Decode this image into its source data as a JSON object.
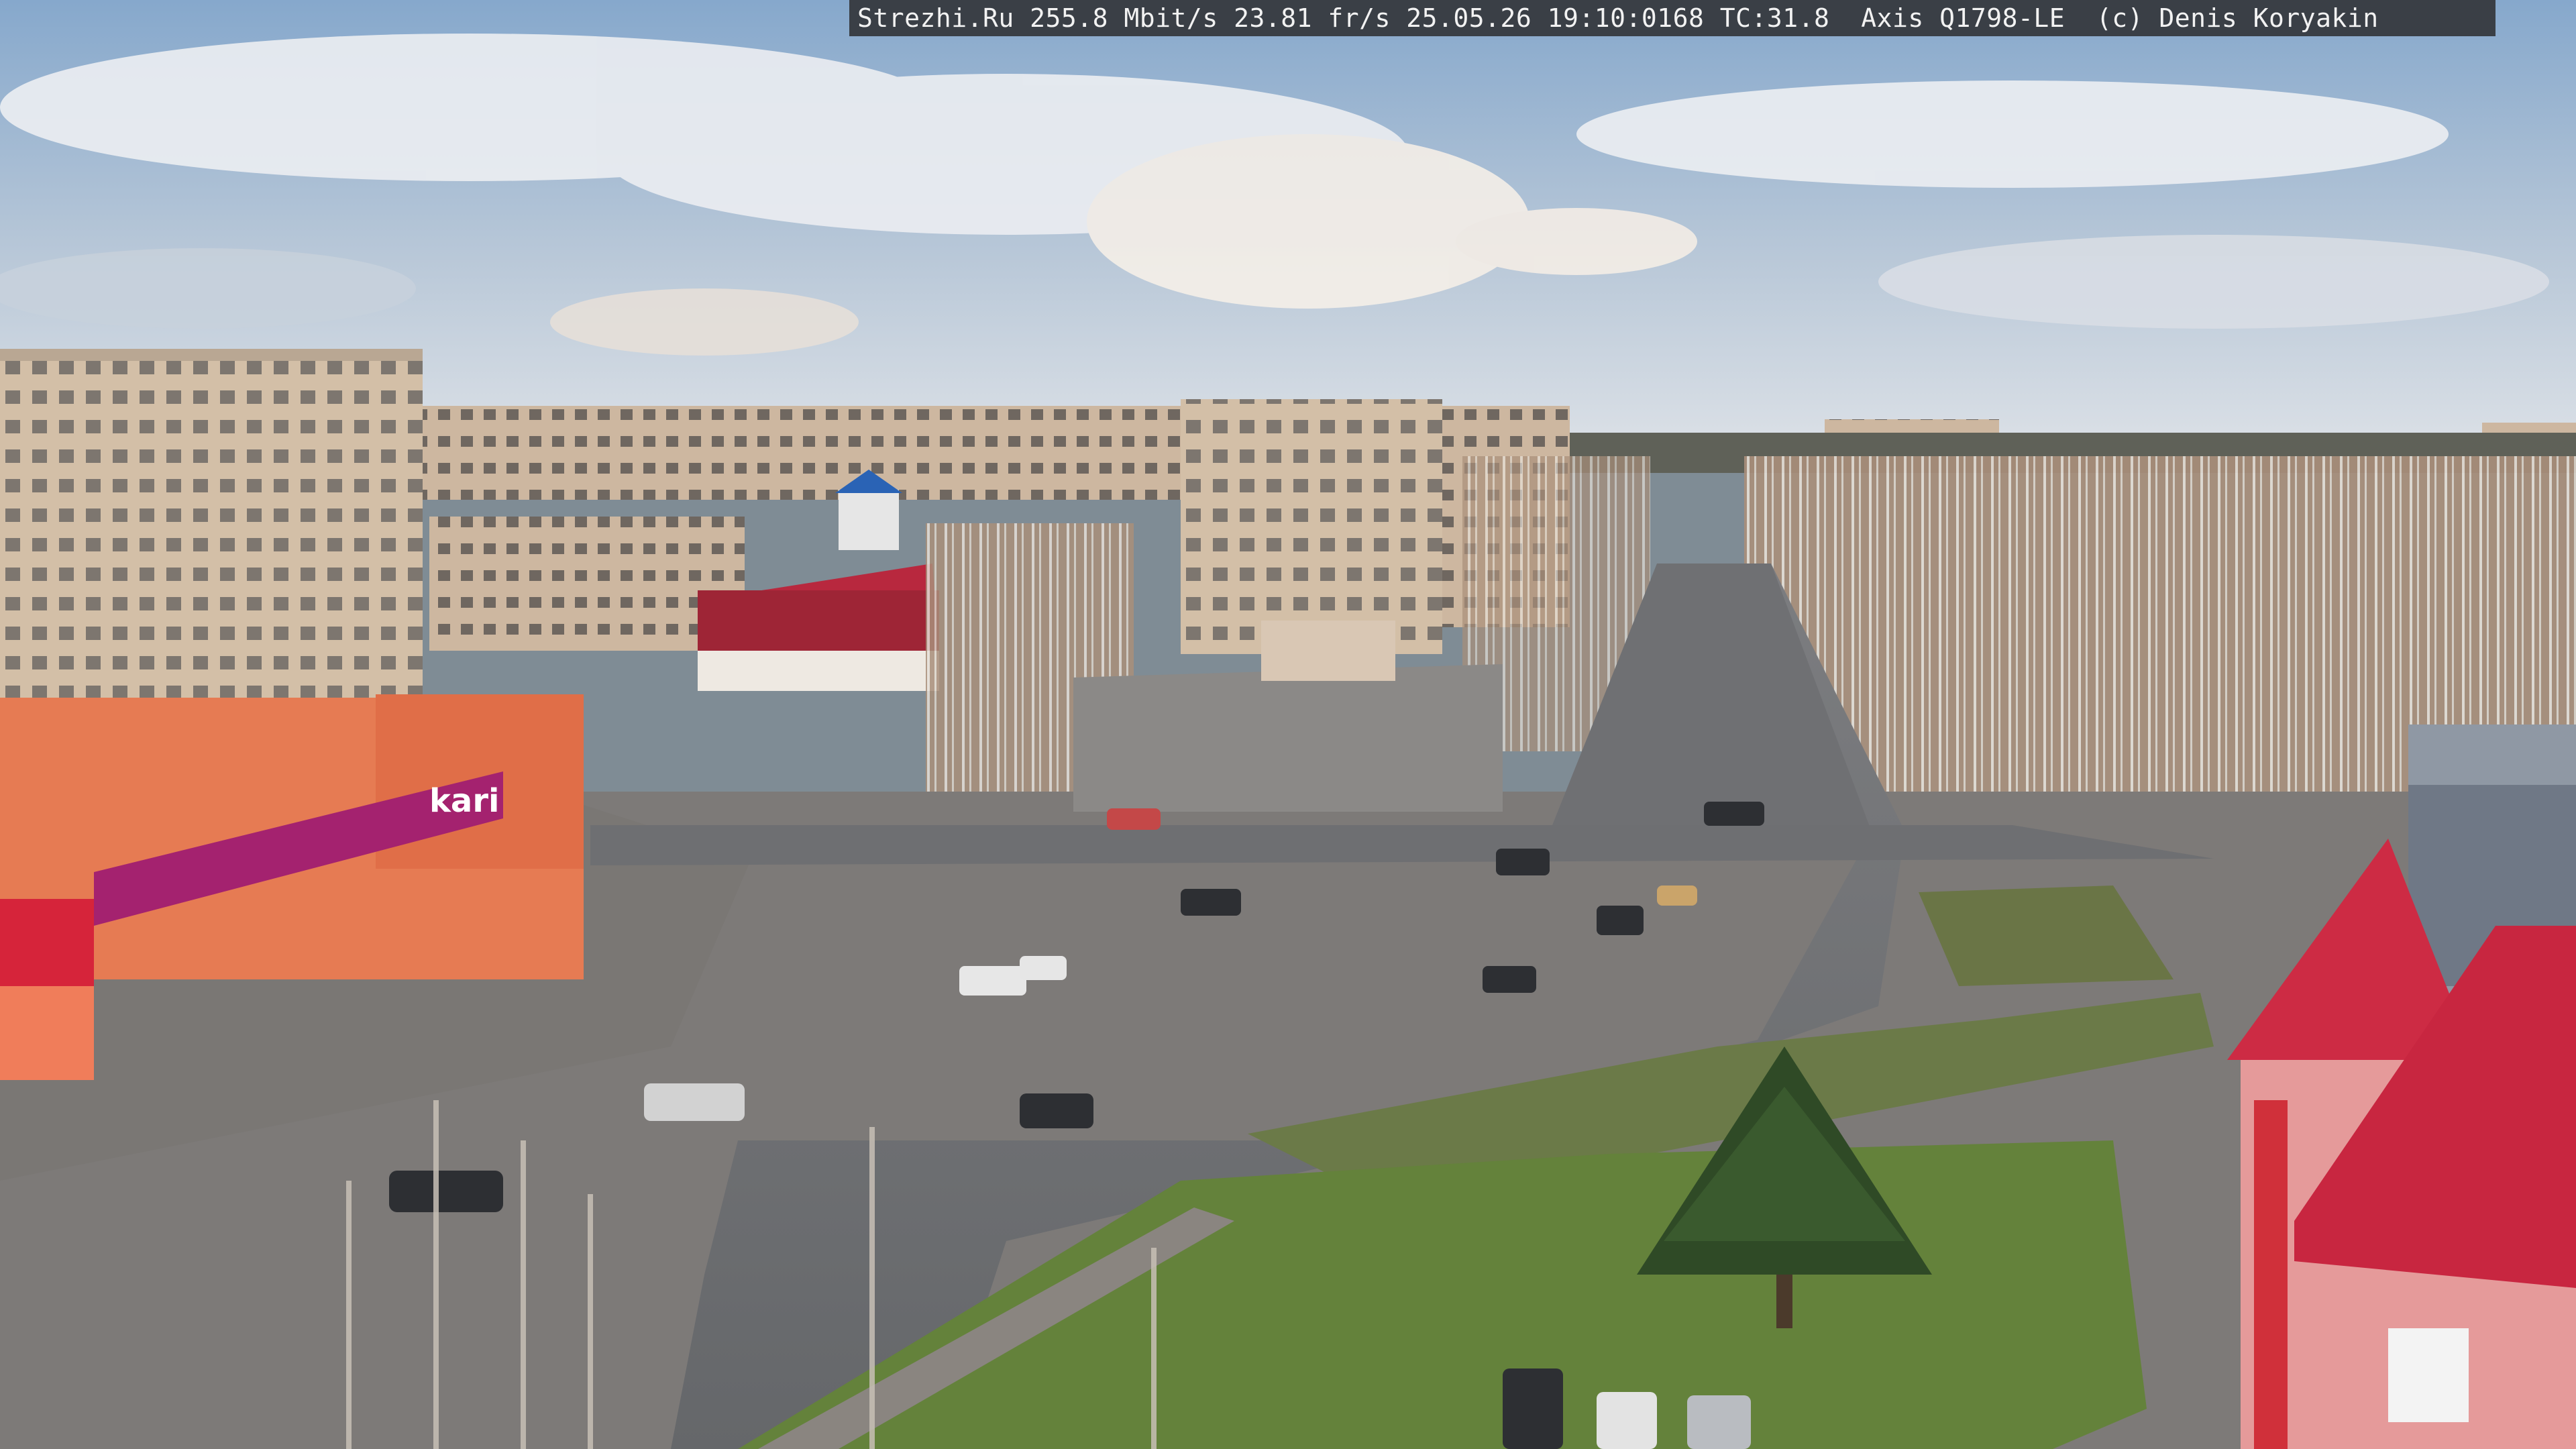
{
  "overlay": {
    "caption": "Strezhi.Ru 255.8 Mbit/s 23.81 fr/s 25.05.26 19:10:0168 TC:31.8  Axis Q1798-LE  (c) Denis Koryakin"
  },
  "signage": {
    "store_brand": "kari"
  },
  "colors": {
    "sky_top": "#8fb0d2",
    "sky_bottom": "#d9dfe6",
    "cloud": "#eef0f3",
    "asphalt": "#6d6e70",
    "plaza": "#8c8a88",
    "grass": "#5f7a3c",
    "red_roof": "#d8304a",
    "brick_orange": "#e87a55",
    "magenta_sign": "#b0267a",
    "panel_building": "#d6c3ad"
  }
}
